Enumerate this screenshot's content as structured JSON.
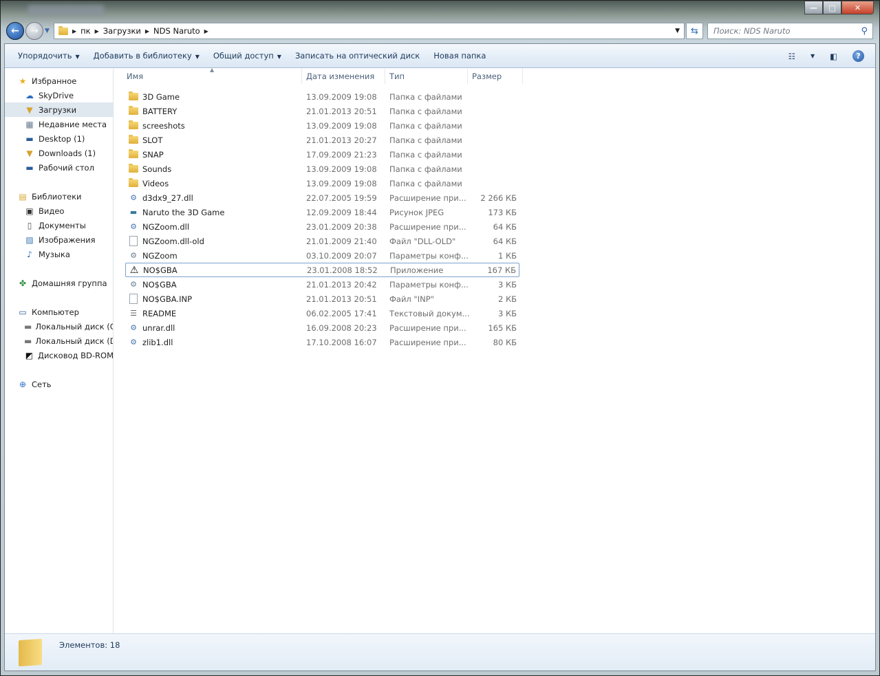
{
  "window": {
    "minimize": "—",
    "maximize": "□",
    "close": "✕"
  },
  "address": {
    "segments": [
      "пк",
      "Загрузки",
      "NDS Naruto"
    ]
  },
  "search": {
    "placeholder": "Поиск: NDS Naruto"
  },
  "toolbar": {
    "organize": "Упорядочить",
    "add_library": "Добавить в библиотеку",
    "share": "Общий доступ",
    "burn": "Записать на оптический диск",
    "new_folder": "Новая папка",
    "help": "?"
  },
  "sidebar": [
    {
      "label": "Избранное",
      "icon": "star-icon",
      "indent": 0
    },
    {
      "label": "SkyDrive",
      "icon": "cloud-icon",
      "indent": 1
    },
    {
      "label": "Загрузки",
      "icon": "downloads-icon",
      "indent": 1,
      "selected": true
    },
    {
      "label": "Недавние места",
      "icon": "recent-icon",
      "indent": 1
    },
    {
      "label": "Desktop (1)",
      "icon": "desktop-icon",
      "indent": 1
    },
    {
      "label": "Downloads (1)",
      "icon": "downloads-icon",
      "indent": 1
    },
    {
      "label": "Рабочий стол",
      "icon": "desktop-icon",
      "indent": 1
    },
    {
      "label": "Библиотеки",
      "icon": "library-icon",
      "indent": 0,
      "gap": true
    },
    {
      "label": "Видео",
      "icon": "video-icon",
      "indent": 1
    },
    {
      "label": "Документы",
      "icon": "documents-icon",
      "indent": 1
    },
    {
      "label": "Изображения",
      "icon": "pictures-icon",
      "indent": 1
    },
    {
      "label": "Музыка",
      "icon": "music-icon",
      "indent": 1
    },
    {
      "label": "Домашняя группа",
      "icon": "homegroup-icon",
      "indent": 0,
      "gap": true
    },
    {
      "label": "Компьютер",
      "icon": "computer-icon",
      "indent": 0,
      "gap": true
    },
    {
      "label": "Локальный диск (C",
      "icon": "drive-icon",
      "indent": 1
    },
    {
      "label": "Локальный диск (D",
      "icon": "drive-icon",
      "indent": 1
    },
    {
      "label": "Дисковод BD-ROM",
      "icon": "bd-rom-icon",
      "indent": 1
    },
    {
      "label": "Сеть",
      "icon": "network-icon",
      "indent": 0,
      "gap": true
    }
  ],
  "columns": {
    "name": "Имя",
    "date": "Дата изменения",
    "type": "Тип",
    "size": "Размер"
  },
  "files": [
    {
      "name": "3D Game",
      "date": "13.09.2009 19:08",
      "type": "Папка с файлами",
      "size": "",
      "icon": "folder"
    },
    {
      "name": "BATTERY",
      "date": "21.01.2013 20:51",
      "type": "Папка с файлами",
      "size": "",
      "icon": "folder"
    },
    {
      "name": "screeshots",
      "date": "13.09.2009 19:08",
      "type": "Папка с файлами",
      "size": "",
      "icon": "folder"
    },
    {
      "name": "SLOT",
      "date": "21.01.2013 20:27",
      "type": "Папка с файлами",
      "size": "",
      "icon": "folder"
    },
    {
      "name": "SNAP",
      "date": "17.09.2009 21:23",
      "type": "Папка с файлами",
      "size": "",
      "icon": "folder"
    },
    {
      "name": "Sounds",
      "date": "13.09.2009 19:08",
      "type": "Папка с файлами",
      "size": "",
      "icon": "folder"
    },
    {
      "name": "Videos",
      "date": "13.09.2009 19:08",
      "type": "Папка с файлами",
      "size": "",
      "icon": "folder"
    },
    {
      "name": "d3dx9_27.dll",
      "date": "22.07.2005 19:59",
      "type": "Расширение при...",
      "size": "2 266 КБ",
      "icon": "dll"
    },
    {
      "name": "Naruto the 3D Game",
      "date": "12.09.2009 18:44",
      "type": "Рисунок JPEG",
      "size": "173 КБ",
      "icon": "image"
    },
    {
      "name": "NGZoom.dll",
      "date": "23.01.2009 20:38",
      "type": "Расширение при...",
      "size": "64 КБ",
      "icon": "dll"
    },
    {
      "name": "NGZoom.dll-old",
      "date": "21.01.2009 21:40",
      "type": "Файл \"DLL-OLD\"",
      "size": "64 КБ",
      "icon": "file"
    },
    {
      "name": "NGZoom",
      "date": "03.10.2009 20:07",
      "type": "Параметры конф...",
      "size": "1 КБ",
      "icon": "config"
    },
    {
      "name": "NO$GBA",
      "date": "23.01.2008 18:52",
      "type": "Приложение",
      "size": "167 КБ",
      "icon": "app",
      "focused": true
    },
    {
      "name": "NO$GBA",
      "date": "21.01.2013 20:42",
      "type": "Параметры конф...",
      "size": "3 КБ",
      "icon": "config"
    },
    {
      "name": "NO$GBA.INP",
      "date": "21.01.2013 20:51",
      "type": "Файл \"INP\"",
      "size": "2 КБ",
      "icon": "file"
    },
    {
      "name": "README",
      "date": "06.02.2005 17:41",
      "type": "Текстовый докум...",
      "size": "3 КБ",
      "icon": "text"
    },
    {
      "name": "unrar.dll",
      "date": "16.09.2008 20:23",
      "type": "Расширение при...",
      "size": "165 КБ",
      "icon": "dll"
    },
    {
      "name": "zlib1.dll",
      "date": "17.10.2008 16:07",
      "type": "Расширение при...",
      "size": "80 КБ",
      "icon": "dll"
    }
  ],
  "status": {
    "count": "Элементов: 18"
  }
}
